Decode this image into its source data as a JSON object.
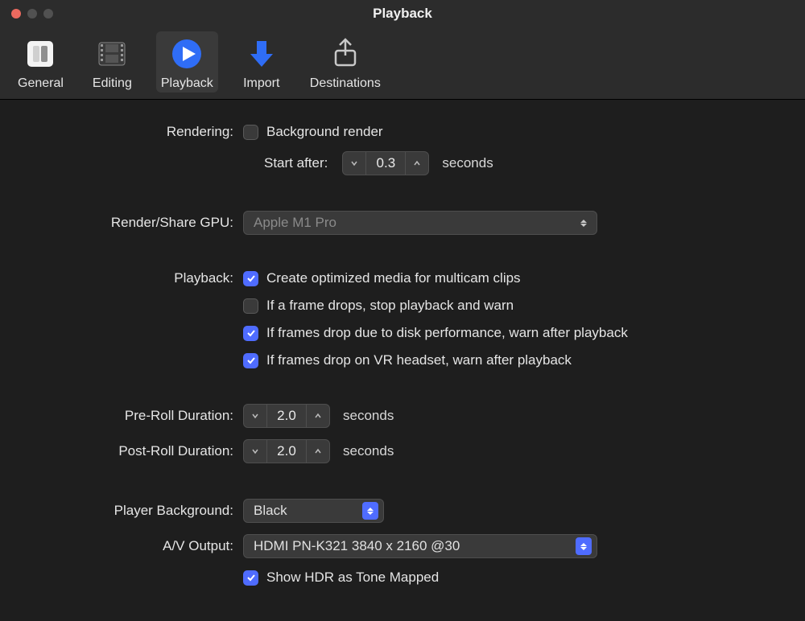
{
  "window": {
    "title": "Playback"
  },
  "toolbar": {
    "items": [
      {
        "label": "General",
        "name": "tab-general"
      },
      {
        "label": "Editing",
        "name": "tab-editing"
      },
      {
        "label": "Playback",
        "name": "tab-playback",
        "selected": true
      },
      {
        "label": "Import",
        "name": "tab-import"
      },
      {
        "label": "Destinations",
        "name": "tab-destinations"
      }
    ]
  },
  "rendering": {
    "label": "Rendering:",
    "background_render": {
      "label": "Background render",
      "checked": false
    },
    "start_after_label": "Start after:",
    "start_after_value": "0.3",
    "seconds": "seconds"
  },
  "gpu": {
    "label": "Render/Share GPU:",
    "value": "Apple M1 Pro",
    "enabled": false
  },
  "playback": {
    "label": "Playback:",
    "opts": [
      {
        "label": "Create optimized media for multicam clips",
        "checked": true
      },
      {
        "label": "If a frame drops, stop playback and warn",
        "checked": false
      },
      {
        "label": "If frames drop due to disk performance, warn after playback",
        "checked": true
      },
      {
        "label": "If frames drop on VR headset, warn after playback",
        "checked": true
      }
    ]
  },
  "preroll": {
    "label": "Pre-Roll Duration:",
    "value": "2.0",
    "suffix": "seconds"
  },
  "postroll": {
    "label": "Post-Roll Duration:",
    "value": "2.0",
    "suffix": "seconds"
  },
  "player_bg": {
    "label": "Player Background:",
    "value": "Black"
  },
  "avout": {
    "label": "A/V Output:",
    "value": "HDMI PN-K321 3840 x 2160 @30"
  },
  "hdr": {
    "label": "Show HDR as Tone Mapped",
    "checked": true
  }
}
